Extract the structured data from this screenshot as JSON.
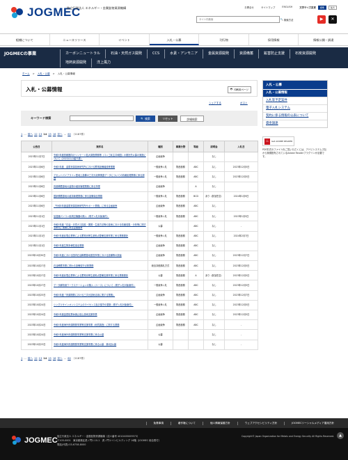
{
  "header": {
    "logo_text": "JOGMEC",
    "org_sub": "独立行政法人 エネルギー・金属鉱物資源機構",
    "util_links": [
      "お問合せ",
      "サイトマップ",
      "ENGLISH"
    ],
    "font_size_label": "文字サイズ変更",
    "font_size_options": [
      "標準",
      "拡大"
    ],
    "search_placeholder": "サイト内検索",
    "search_btn": "検索方法"
  },
  "gnav": [
    "組織について",
    "ニュースリリース",
    "イベント",
    "入札・公募",
    "刊行物",
    "採用情報",
    "情報公開・調達"
  ],
  "subnav": {
    "title": "JOGMECの事業",
    "links": [
      "カーボンニュートラル",
      "石油・天然ガス開発",
      "CCS",
      "水素・アンモニア",
      "金属資源開発",
      "資源備蓄",
      "鉱害防止支援",
      "石炭資源開発",
      "地熱資源開発",
      "洋上風力"
    ]
  },
  "breadcrumb": [
    "ホーム",
    "入札・公募",
    "入札・公募情報"
  ],
  "page": {
    "title": "入札・公募情報",
    "print_label": "印刷用ページ",
    "share_label": "シェアする",
    "post_label": "ポスト",
    "keyword_label": "キーワード検索",
    "search_btn": "検索",
    "reset_btn": "リセット",
    "detail_btn": "詳細検索"
  },
  "pager": {
    "items": [
      "1",
      "…",
      "前へ",
      "12",
      "13",
      "14",
      "15",
      "16",
      "次へ",
      "…",
      "60"
    ],
    "total": "（1187件）"
  },
  "table": {
    "headers": [
      "公告日",
      "案件名",
      "種別",
      "事業分野",
      "等級",
      "説明会",
      "入札日"
    ],
    "rows": [
      [
        "2023年11月7日",
        "令和5年度首都圏向けリンケージ拡大調査業務等（コンゴ民主共和国）の委託先公募の実施について（2023/11/1紹介済）",
        "企画競争",
        "",
        "",
        "なし",
        ""
      ],
      [
        "2023年11月6日",
        "令和5年度　金属資源技術研究所における蓄電設備増設等業務",
        "一般競争入札",
        "物品役務",
        "ABC",
        "なし",
        "2023年12月5日"
      ],
      [
        "2023年11月6日",
        "アセットパイプライン型地上設備の三次元化等関連データについての情報処理業務に係る調査",
        "一般競争入札",
        "物品役務",
        "ABC",
        "なし",
        "2023年12月5日"
      ],
      [
        "2023年11月6日",
        "資源備蓄基地の建物の維持管理業務に係る事業",
        "企画競争",
        "",
        "A",
        "なし",
        ""
      ],
      [
        "2023年11月6日",
        "国家備蓄基地の維持管理業務に係る設備保全業務",
        "一般競争入札",
        "物品役務",
        "BCD",
        "あり（参加任意）",
        "2024年1月9日"
      ],
      [
        "2023年11月6日",
        "「令和5年度金属資源技術研究所サポート業務」に係る企画競争",
        "企画競争",
        "物品役務",
        "ABC",
        "なし",
        ""
      ],
      [
        "2023年11月1日",
        "加湿器パソコン用周辺機器の購入（電子入札対象案件）",
        "一般競争入札",
        "物品役務",
        "ABC",
        "なし",
        "2023年1月5日"
      ],
      [
        "2023年11月1日",
        "令和5年度「石油・天然ガス探鉱・開発・生産方法等の技術における情報収集・分析等に関する研究」業務に係る企画競争",
        "公募",
        "",
        "ABC",
        "なし",
        "-"
      ],
      [
        "2023年11月1日",
        "令和5年度民間企業等による蓄電池等生産拠点整備支援事業に係る業務委託",
        "一般競争入札",
        "物品役務",
        "ABC",
        "なし",
        "2024年2月7日"
      ],
      [
        "2023年11月1日",
        "令和5年度生物多様性保全業務",
        "企画競争",
        "物品役務",
        "ABC",
        "なし",
        ""
      ],
      [
        "2023年10月30日",
        "令和5年度における国内石油備蓄基地運営事業における設備等の調達",
        "企画競争",
        "物品役務",
        "ABC",
        "なし",
        "2023年12月7日"
      ],
      [
        "2023年10月27日",
        "石油備蓄事業に関わる設備保守点検業務",
        "総合評価落札方式",
        "物品役務",
        "ABC",
        "なし",
        "2023年12月5日"
      ],
      [
        "2023年10月27日",
        "令和5年度民間企業等による蓄電池等生産拠点整備支援事業に係る業務委託",
        "公募",
        "物品役務",
        "A",
        "あり（参加任意）",
        "2023年12月5日"
      ],
      [
        "2023年10月27日",
        "データ解析用ワークステーションの購入（リース）について（電子入札対象案件）",
        "一般競争入札",
        "物品役務",
        "ABC",
        "なし",
        "2023年12月5日"
      ],
      [
        "2023年10月25日",
        "令和5年度「資源開発における三次元技術活用に関する業務」",
        "企画競争",
        "物品役務",
        "ABC",
        "なし",
        "2023年12月7日"
      ],
      [
        "2023年10月24日",
        "シングルサインオンシステムのライセンス及び保守の更新（電子入札対象案件）",
        "一般競争入札",
        "物品役務",
        "ABC",
        "なし",
        "2023年12月5日"
      ],
      [
        "2023年10月24日",
        "令和5年度金属鉱業休廃止鉱山技術支援事業",
        "企画競争",
        "物品役務",
        "ABC",
        "なし",
        "2023年12月5日"
      ],
      [
        "2023年10月24日",
        "令和5年度海外資源開発事業等支援事業（地質調査）に関する業務",
        "企画競争",
        "物品役務",
        "ABC",
        "なし",
        "-"
      ],
      [
        "2023年10月24日",
        "令和5年度海外資源開発事業等支援事業に係る公募",
        "公募",
        "",
        "",
        "なし",
        "-"
      ],
      [
        "2023年10月23日",
        "令和5年度海外資源開発事業等支援事業に係る公募　第2回公募",
        "公募",
        "",
        "",
        "なし",
        "-"
      ]
    ]
  },
  "sidebar": {
    "head": "入札・公募",
    "items": [
      "入札・公募情報",
      "入札等予定案件",
      "電子入札システム",
      "契約に係る情報の公表について",
      "資金調達"
    ],
    "adobe_label": "Get ADOBE READER",
    "adobe_note": "PDF形式のファイルをご覧いただくには、アドビシステムズ社から無償配布されているAdobe Readerプラグインが必要です。"
  },
  "footer": {
    "links": [
      "免責事項",
      "著作権について",
      "個人情報保護方針",
      "ウェブアクセシビリティ方針",
      "JOGMECソーシャルメディア運用方針"
    ],
    "logo_text": "JOGMEC",
    "org": "独立行政法人 エネルギー・金属鉱物資源機構（法人番号 4010405009573）",
    "address": "〒105-0001　東京都港区虎ノ門2-10-1　虎ノ門ツインビルディング 16階（JOGMEC 総合受付）",
    "tel": "電話(代表):03-6758-8000",
    "copyright": "Copyright© Japan Organization for Metals and Energy Security All Rights Reserved."
  },
  "colors": {
    "brand": "#0a3c8c",
    "dark_nav": "#1a2b44",
    "search_btn": "#1c4e9c",
    "reset_btn": "#555555"
  }
}
